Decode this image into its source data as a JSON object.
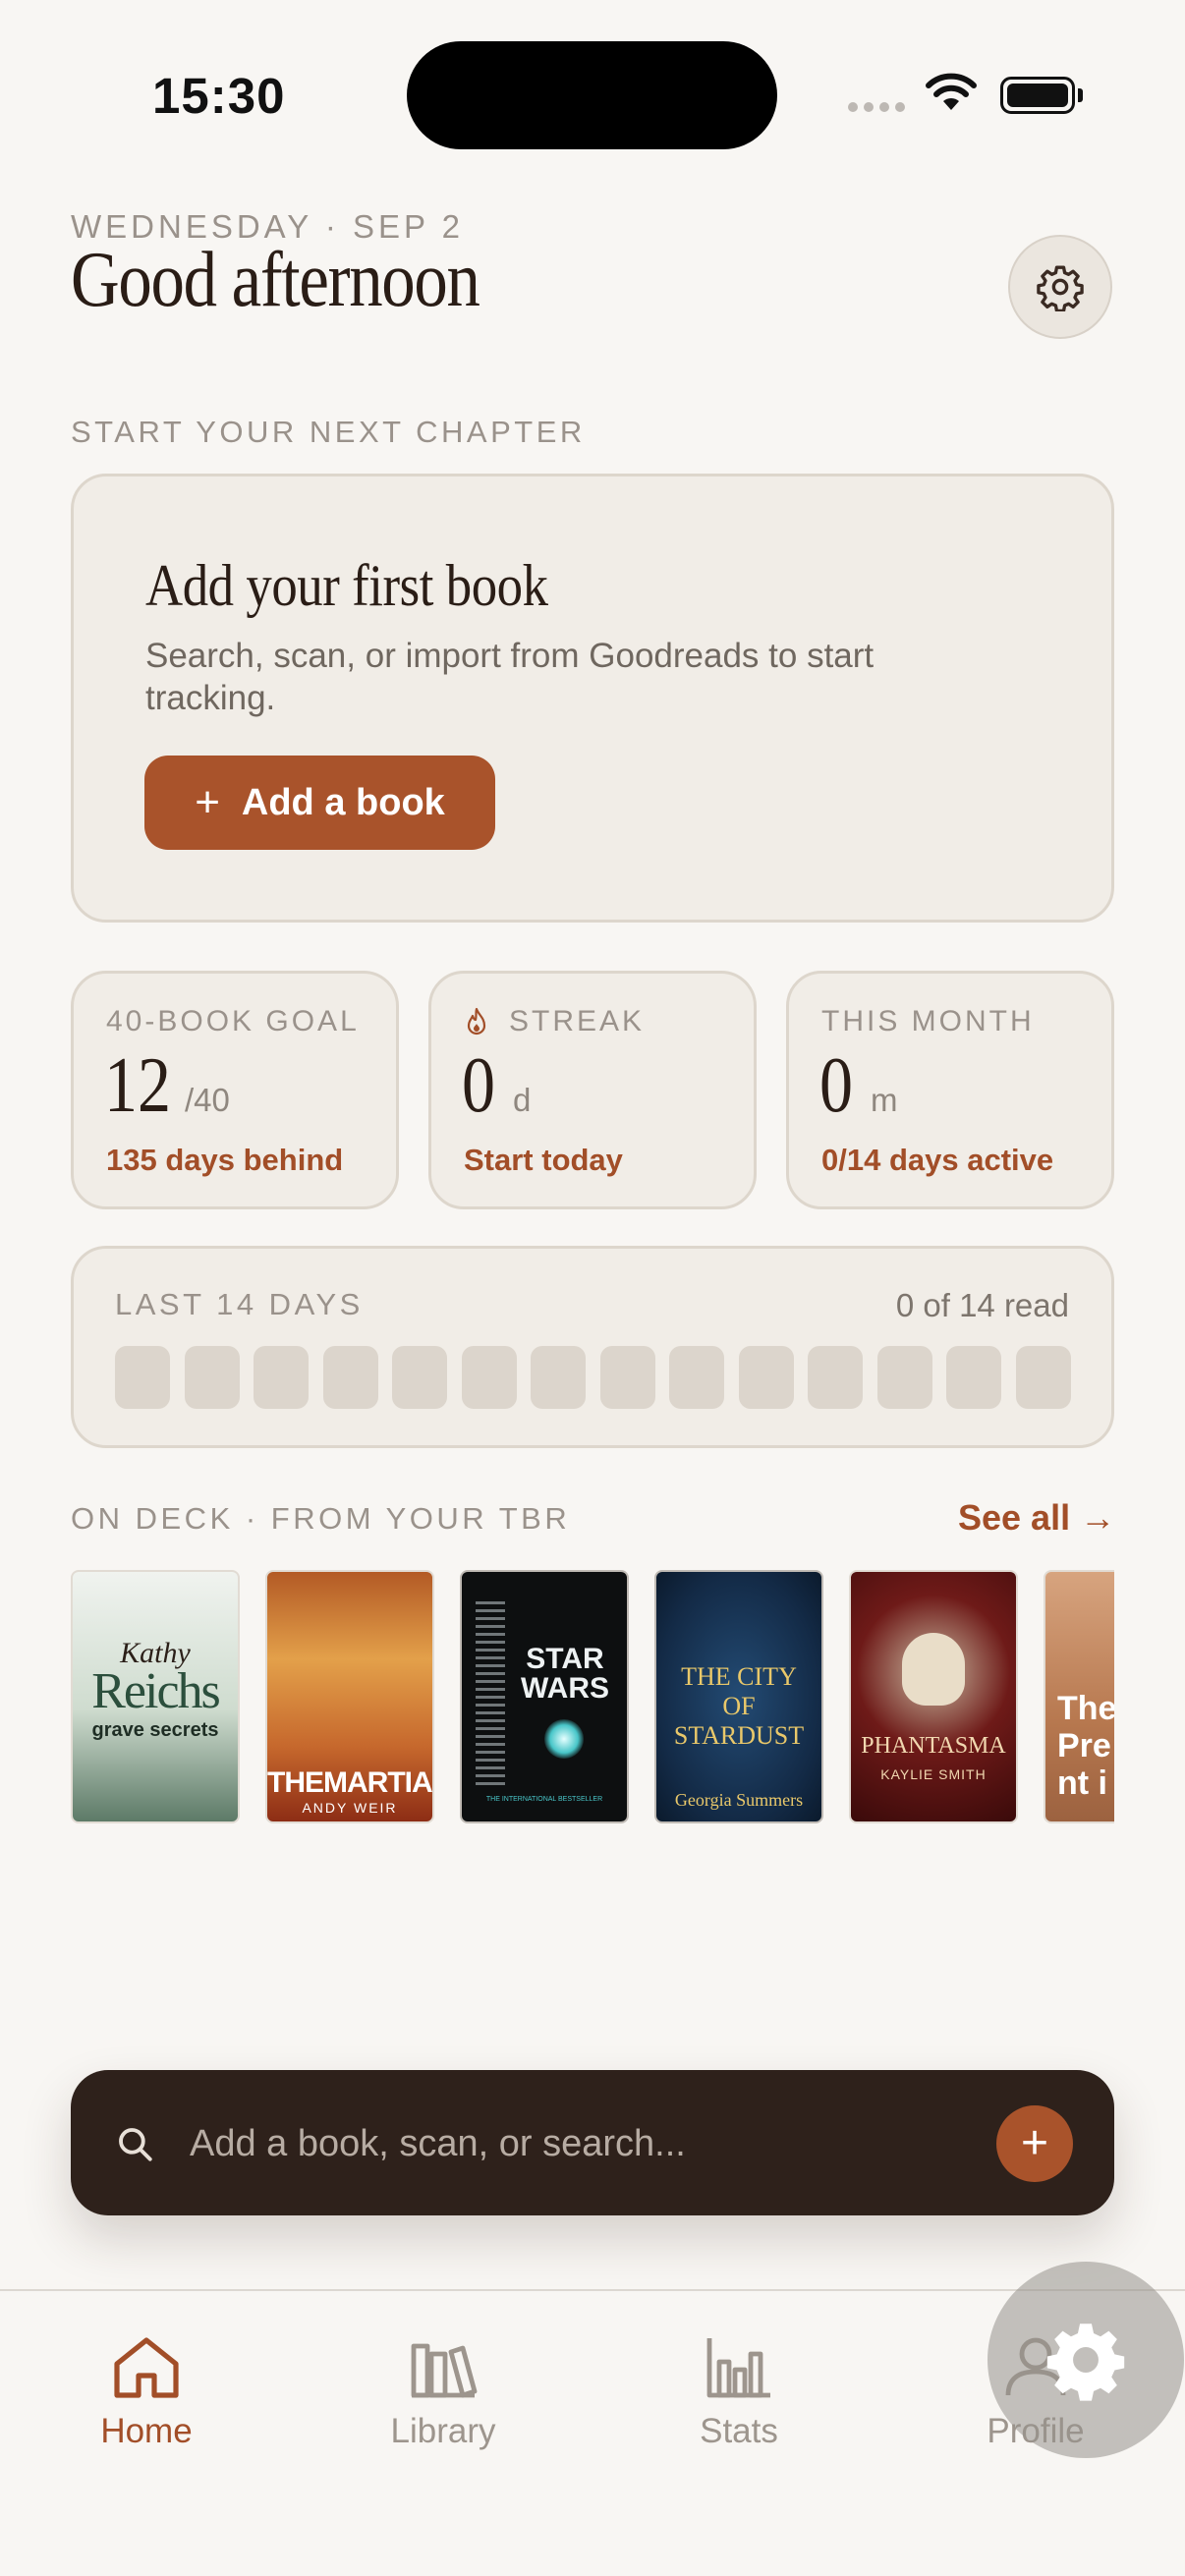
{
  "status_bar": {
    "time": "15:30"
  },
  "header": {
    "date": "WEDNESDAY · SEP 2",
    "greeting": "Good afternoon"
  },
  "start_section": {
    "label": "START YOUR NEXT CHAPTER",
    "card_title": "Add your first book",
    "card_description": "Search, scan, or import from Goodreads to start tracking.",
    "button_label": "Add a book"
  },
  "stats": [
    {
      "label": "40-BOOK GOAL",
      "value": "12",
      "unit": "/40",
      "note": "135 days behind"
    },
    {
      "label": "STREAK",
      "value": "0",
      "unit": "d",
      "note": "Start today",
      "icon": "flame-icon"
    },
    {
      "label": "THIS MONTH",
      "value": "0",
      "unit": "m",
      "note": "0/14 days active"
    }
  ],
  "last_days": {
    "label": "LAST 14 DAYS",
    "count": "0 of 14 read",
    "days_read": 0,
    "days_total": 14
  },
  "on_deck": {
    "label": "ON DECK · FROM YOUR TBR",
    "see_all": "See all →",
    "books": [
      {
        "author": "Kathy",
        "title_line1": "Reichs",
        "title_line2": "grave secrets",
        "bg": "#dfe8df",
        "fg": "#2c4f3d"
      },
      {
        "author": "ANDY WEIR",
        "title_line1": "THE",
        "title_line2": "MARTIAN",
        "bg": "#c8662c",
        "fg": "#ffffff"
      },
      {
        "author": "THE INTERNATIONAL BESTSELLER",
        "title_line1": "STAR",
        "title_line2": "WARS",
        "bg": "#0d0f10",
        "fg": "#e8eef0"
      },
      {
        "author": "Georgia Summers",
        "title_line1": "THE CITY",
        "title_line2": "OF STARDUST",
        "bg": "#1b3556",
        "fg": "#e9c86a"
      },
      {
        "author": "KAYLIE SMITH",
        "title_line1": "PHANTASMA",
        "title_line2": "",
        "bg": "#5b0e10",
        "fg": "#f1d7b0"
      },
      {
        "author": "",
        "title_line1": "The",
        "title_line2": "Pre",
        "title_line3": "nt i",
        "bg": "#b7784f",
        "fg": "#ffffff"
      }
    ]
  },
  "search": {
    "placeholder": "Add a book, scan, or search..."
  },
  "tabs": [
    {
      "label": "Home",
      "icon": "home-icon",
      "active": true
    },
    {
      "label": "Library",
      "icon": "library-icon",
      "active": false
    },
    {
      "label": "Stats",
      "icon": "stats-icon",
      "active": false
    },
    {
      "label": "Profile",
      "icon": "profile-icon",
      "active": false
    }
  ],
  "colors": {
    "accent": "#a9532b",
    "background": "#f8f6f3",
    "card": "#f1ede7",
    "search_bar": "#2e211b"
  }
}
